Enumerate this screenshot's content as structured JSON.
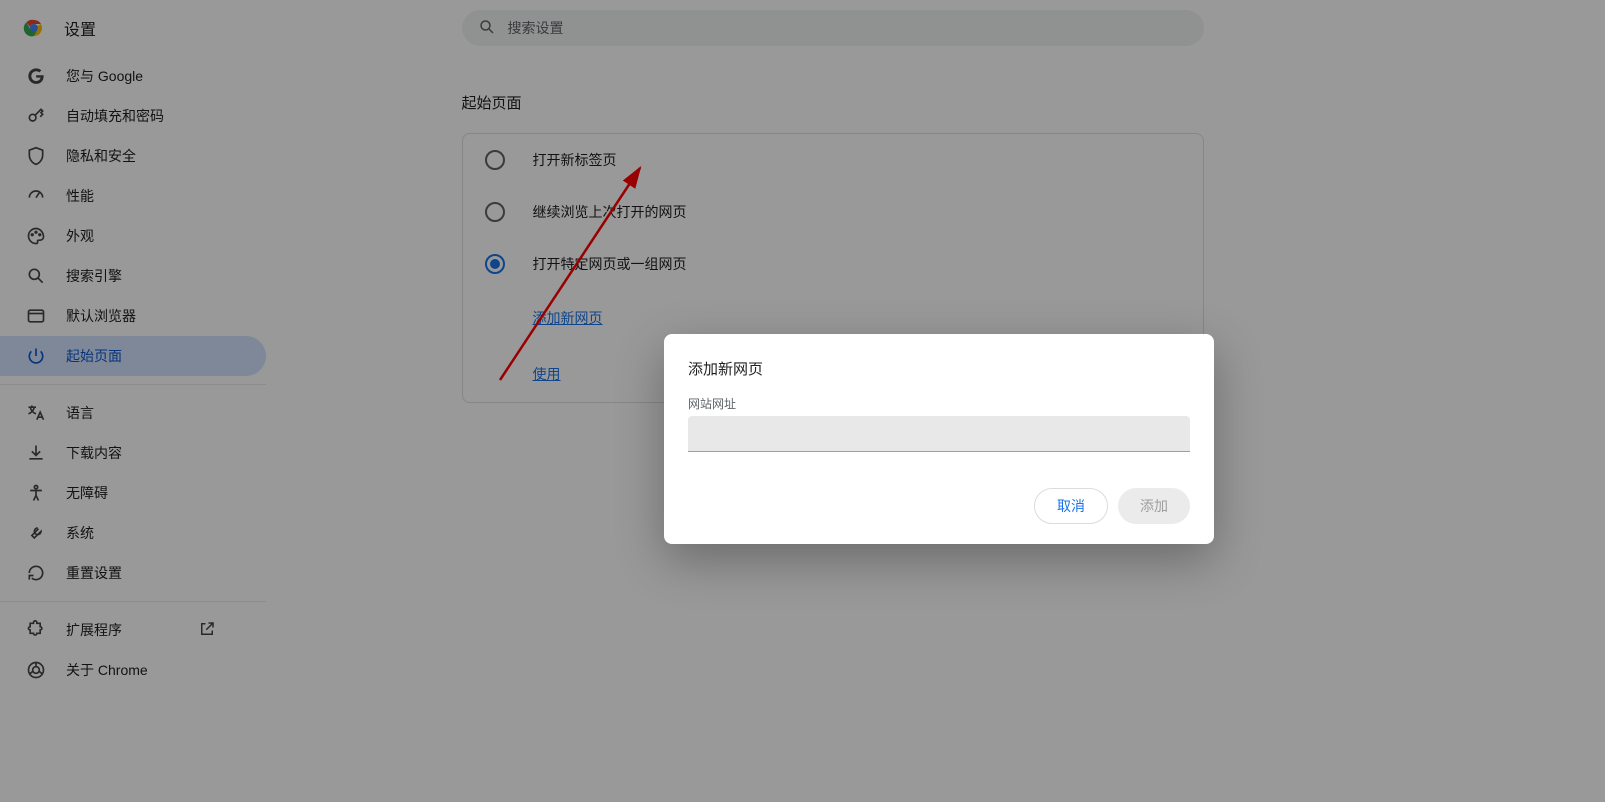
{
  "header": {
    "title": "设置"
  },
  "search": {
    "placeholder": "搜索设置"
  },
  "sidebar": {
    "groups": [
      [
        {
          "id": "you-and-google",
          "label": "您与 Google",
          "icon": "google"
        },
        {
          "id": "autofill",
          "label": "自动填充和密码",
          "icon": "key"
        },
        {
          "id": "privacy",
          "label": "隐私和安全",
          "icon": "shield"
        },
        {
          "id": "performance",
          "label": "性能",
          "icon": "speed"
        },
        {
          "id": "appearance",
          "label": "外观",
          "icon": "palette"
        },
        {
          "id": "search-engine",
          "label": "搜索引擎",
          "icon": "search"
        },
        {
          "id": "default-browser",
          "label": "默认浏览器",
          "icon": "browser"
        },
        {
          "id": "on-startup",
          "label": "起始页面",
          "icon": "power",
          "active": true
        }
      ],
      [
        {
          "id": "languages",
          "label": "语言",
          "icon": "lang"
        },
        {
          "id": "downloads",
          "label": "下载内容",
          "icon": "download"
        },
        {
          "id": "accessibility",
          "label": "无障碍",
          "icon": "a11y"
        },
        {
          "id": "system",
          "label": "系统",
          "icon": "wrench"
        },
        {
          "id": "reset",
          "label": "重置设置",
          "icon": "reset"
        }
      ],
      [
        {
          "id": "extensions",
          "label": "扩展程序",
          "icon": "extension",
          "external": true
        },
        {
          "id": "about",
          "label": "关于 Chrome",
          "icon": "chrome"
        }
      ]
    ]
  },
  "main": {
    "section_title": "起始页面",
    "options": [
      {
        "id": "new-tab",
        "label": "打开新标签页"
      },
      {
        "id": "continue",
        "label": "继续浏览上次打开的网页"
      },
      {
        "id": "specific",
        "label": "打开特定网页或一组网页",
        "selected": true
      }
    ],
    "links": {
      "add_new_page": "添加新网页",
      "use_current": "使用"
    }
  },
  "dialog": {
    "title": "添加新网页",
    "field_label": "网站网址",
    "input_value": "",
    "cancel": "取消",
    "add": "添加"
  }
}
